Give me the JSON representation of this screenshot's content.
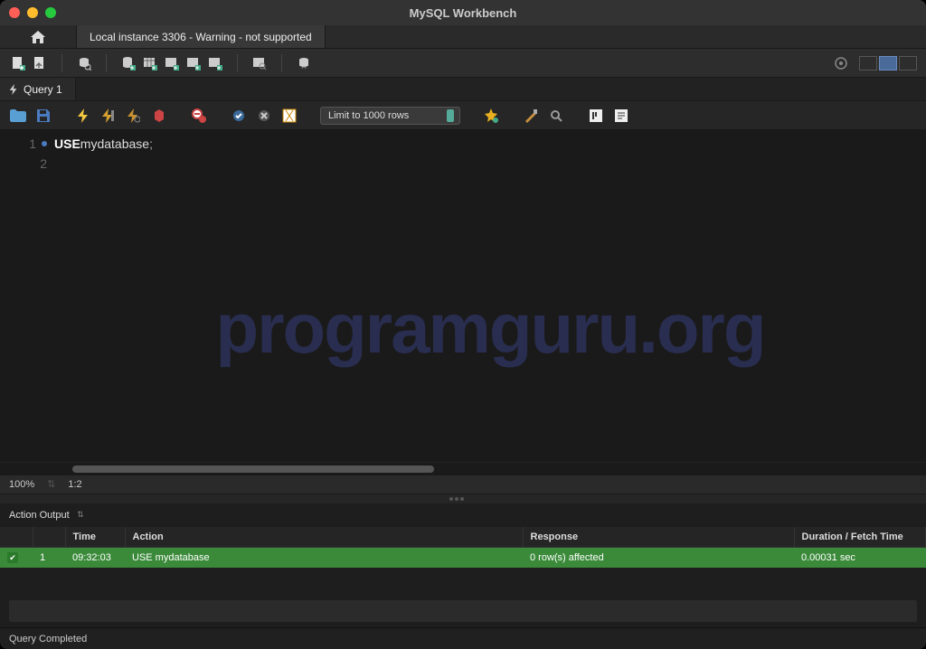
{
  "window": {
    "title": "MySQL Workbench"
  },
  "connection_tab": {
    "label": "Local instance 3306 - Warning - not supported"
  },
  "query_tab": {
    "label": "Query 1"
  },
  "editor_toolbar": {
    "limit_label": "Limit to 1000 rows"
  },
  "code": {
    "lines": [
      {
        "num": "1",
        "active": true,
        "tokens": [
          {
            "t": "USE",
            "c": "kw"
          },
          {
            "t": " ",
            "c": ""
          },
          {
            "t": "mydatabase",
            "c": "ident"
          },
          {
            "t": ";",
            "c": "punct"
          }
        ]
      },
      {
        "num": "2",
        "active": false,
        "tokens": []
      }
    ]
  },
  "watermark": "programguru.org",
  "editor_status": {
    "zoom": "100%",
    "pos": "1:2"
  },
  "output": {
    "dropdown": "Action Output",
    "columns": {
      "time": "Time",
      "action": "Action",
      "response": "Response",
      "duration": "Duration / Fetch Time"
    },
    "rows": [
      {
        "num": "1",
        "time": "09:32:03",
        "action": "USE mydatabase",
        "response": "0 row(s) affected",
        "duration": "0.00031 sec"
      }
    ]
  },
  "bottom_status": "Query Completed"
}
